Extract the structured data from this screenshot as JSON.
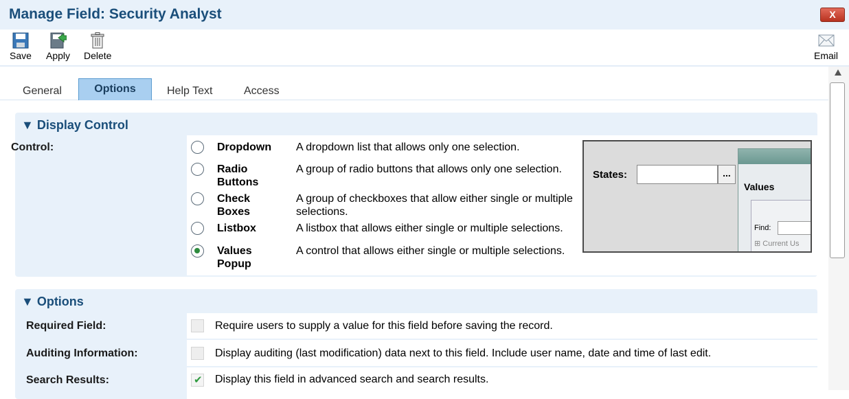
{
  "window": {
    "title": "Manage Field: Security Analyst",
    "close_label": "X"
  },
  "toolbar": {
    "save_label": "Save",
    "apply_label": "Apply",
    "delete_label": "Delete",
    "email_label": "Email"
  },
  "tabs": [
    {
      "label": "General",
      "active": false
    },
    {
      "label": "Options",
      "active": true
    },
    {
      "label": "Help Text",
      "active": false
    },
    {
      "label": "Access",
      "active": false
    }
  ],
  "display_control": {
    "heading": "▼ Display Control",
    "label": "Control:",
    "options": [
      {
        "name": "Dropdown",
        "desc": "A dropdown list that allows only one selection.",
        "selected": false
      },
      {
        "name": "Radio Buttons",
        "desc": "A group of radio buttons that allows only one selection.",
        "selected": false
      },
      {
        "name": "Check Boxes",
        "desc": "A group of checkboxes that allow either single or multiple selections.",
        "selected": false
      },
      {
        "name": "Listbox",
        "desc": "A listbox that allows either single or multiple selections.",
        "selected": false
      },
      {
        "name": "Values Popup",
        "desc": "A control that allows either single or multiple selections.",
        "selected": true
      }
    ],
    "preview": {
      "states_label": "States:",
      "dots": "...",
      "values_title": "Values",
      "find_label": "Find:",
      "current_label": "⊞ Current Us"
    }
  },
  "options": {
    "heading": "▼ Options",
    "rows": [
      {
        "label": "Required Field:",
        "desc": "Require users to supply a value for this field before saving the record.",
        "checked": false
      },
      {
        "label": "Auditing Information:",
        "desc": "Display auditing (last modification) data next to this field. Include user name, date and time of last edit.",
        "checked": false
      },
      {
        "label": "Search Results:",
        "desc": "Display this field in advanced search and search results.",
        "checked": true
      }
    ]
  },
  "colors": {
    "accent": "#1a4e7a",
    "section_bg": "#e8f1fa",
    "active_tab": "#a9cff0",
    "check": "#2e9a3e"
  }
}
